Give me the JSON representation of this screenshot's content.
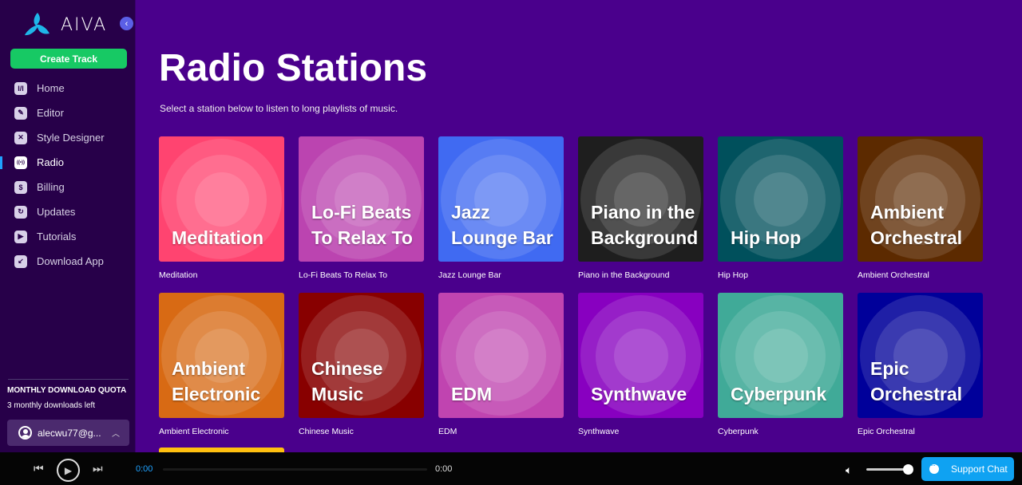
{
  "app": {
    "name": "AIVA"
  },
  "sidebar": {
    "create_label": "Create Track",
    "items": [
      {
        "label": "Home",
        "icon": "home-icon",
        "glyph": "I/I",
        "active": false
      },
      {
        "label": "Editor",
        "icon": "editor-pencil-icon",
        "glyph": "✎",
        "active": false
      },
      {
        "label": "Style Designer",
        "icon": "style-designer-icon",
        "glyph": "✕",
        "active": false
      },
      {
        "label": "Radio",
        "icon": "radio-broadcast-icon",
        "glyph": "((•))",
        "active": true
      },
      {
        "label": "Billing",
        "icon": "dollar-icon",
        "glyph": "$",
        "active": false
      },
      {
        "label": "Updates",
        "icon": "refresh-icon",
        "glyph": "↻",
        "active": false
      },
      {
        "label": "Tutorials",
        "icon": "play-icon",
        "glyph": "▶",
        "active": false
      },
      {
        "label": "Download App",
        "icon": "download-icon",
        "glyph": "↙",
        "active": false
      }
    ],
    "quota_title": "MONTHLY DOWNLOAD QUOTA",
    "quota_text": "3 monthly downloads left",
    "account_email": "alecwu77@g..."
  },
  "main": {
    "title": "Radio Stations",
    "subtitle": "Select a station below to listen to long playlists of music.",
    "stations": [
      {
        "title": "Meditation",
        "label": "Meditation",
        "color": "#ff4470"
      },
      {
        "title": "Lo-Fi Beats To Relax To",
        "label": "Lo-Fi Beats To Relax To",
        "color": "#bb44b0"
      },
      {
        "title": "Jazz Lounge Bar",
        "label": "Jazz Lounge Bar",
        "color": "#406af2"
      },
      {
        "title": "Piano in the Background",
        "label": "Piano in the Background",
        "color": "#1e1e1e"
      },
      {
        "title": "Hip Hop",
        "label": "Hip Hop",
        "color": "#00505c"
      },
      {
        "title": "Ambient Orchestral",
        "label": "Ambient Orchestral",
        "color": "#5c2a00"
      },
      {
        "title": "Ambient Electronic",
        "label": "Ambient Electronic",
        "color": "#d86a14"
      },
      {
        "title": "Chinese Music",
        "label": "Chinese Music",
        "color": "#880000"
      },
      {
        "title": "EDM",
        "label": "EDM",
        "color": "#c044b0"
      },
      {
        "title": "Synthwave",
        "label": "Synthwave",
        "color": "#8800c0"
      },
      {
        "title": "Cyberpunk",
        "label": "Cyberpunk",
        "color": "#40aa98"
      },
      {
        "title": "Epic Orchestral",
        "label": "Epic Orchestral",
        "color": "#00009a"
      }
    ],
    "partial_next_color": "#ffc010"
  },
  "player": {
    "current_time": "0:00",
    "duration": "0:00",
    "volume": 1.0,
    "support_label": "Support Chat"
  }
}
